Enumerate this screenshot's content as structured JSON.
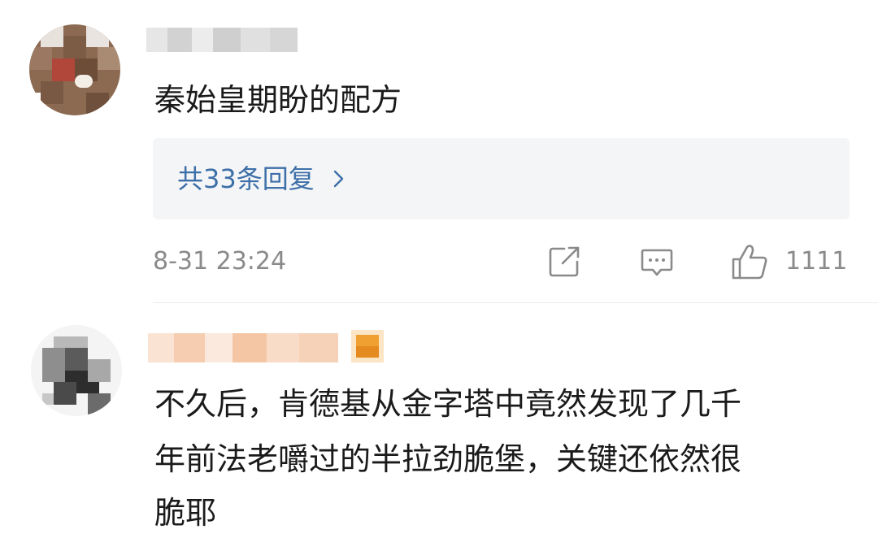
{
  "comments": [
    {
      "username_visible": "",
      "text": "秦始皇期盼的配方",
      "replies_label": "共33条回复",
      "timestamp": "8-31 23:24",
      "like_count": "1111"
    },
    {
      "username_visible": "",
      "text_lines": [
        "不久后，肯德基从金字塔中竟然发现了几千",
        "年前法老嚼过的半拉劲脆堡，关键还依然很",
        "脆耶"
      ]
    }
  ],
  "icons": {
    "share": "share-icon",
    "comment": "comment-icon",
    "like": "thumbs-up-icon",
    "chevron": "chevron-right-icon"
  },
  "colors": {
    "link": "#3d6fa8",
    "meta_text": "#8a8a8a",
    "reply_box_bg": "#f4f5f7",
    "badge": "#f0a030"
  }
}
